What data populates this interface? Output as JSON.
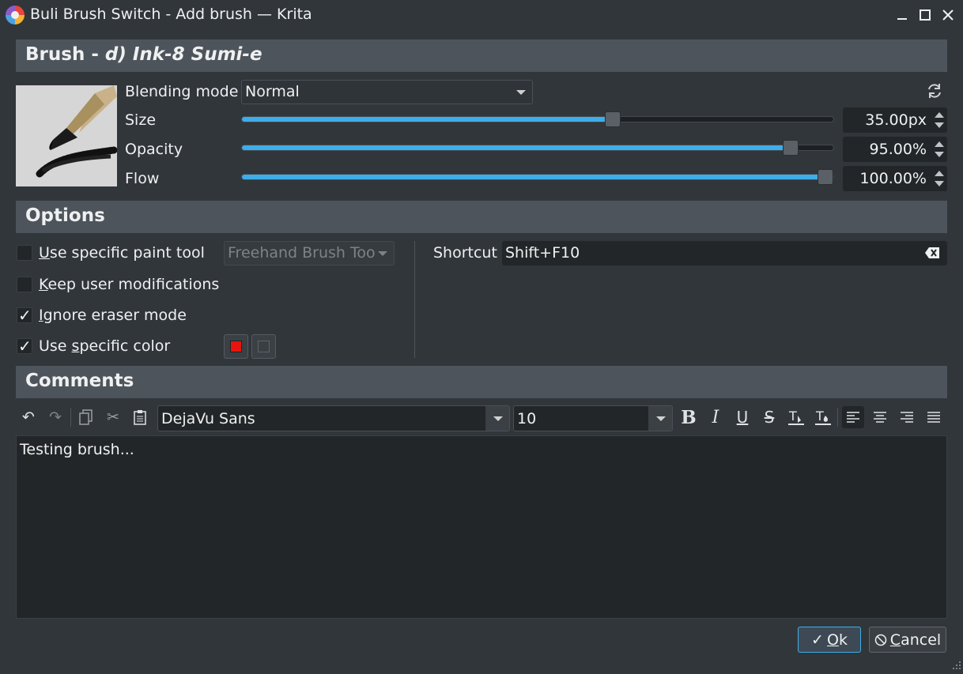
{
  "window": {
    "title": "Buli Brush Switch - Add brush — Krita",
    "minimize": "–",
    "maximize": "☐",
    "close": "✕"
  },
  "brush": {
    "header_prefix": "Brush - ",
    "header_name": "d) Ink-8 Sumi-e",
    "blending_mode_label": "Blending mode",
    "blending_mode_value": "Normal",
    "size_label": "Size",
    "size_value": "35.00px",
    "size_fraction": 0.63,
    "opacity_label": "Opacity",
    "opacity_value": "95.00%",
    "opacity_fraction": 0.94,
    "flow_label": "Flow",
    "flow_value": "100.00%",
    "flow_fraction": 1.0
  },
  "options": {
    "header": "Options",
    "use_specific_paint_tool": {
      "label_u": "U",
      "label_rest": "se specific paint tool",
      "checked": false
    },
    "paint_tool_value": "Freehand Brush Too",
    "keep_user_modifications": {
      "label_u": "K",
      "label_rest": "eep user modifications",
      "checked": false
    },
    "ignore_eraser_mode": {
      "label_u": "I",
      "label_rest": "gnore eraser mode",
      "checked": true
    },
    "use_specific_color": {
      "label_pre": "Use ",
      "label_u": "s",
      "label_rest": "pecific color",
      "checked": true
    },
    "foreground_color": "#e8150f",
    "background_color": "#3a3f44",
    "shortcut_label": "Shortcut",
    "shortcut_value": "Shift+F10"
  },
  "comments": {
    "header": "Comments",
    "font_value": "DejaVu Sans",
    "size_value": "10",
    "text": "Testing brush..."
  },
  "buttons": {
    "ok_u": "O",
    "ok_rest": "k",
    "cancel_u": "C",
    "cancel_rest": "ancel"
  },
  "colors": {
    "accent": "#3daee9",
    "window_bg": "#31363b",
    "header_bg": "#4d545b"
  }
}
